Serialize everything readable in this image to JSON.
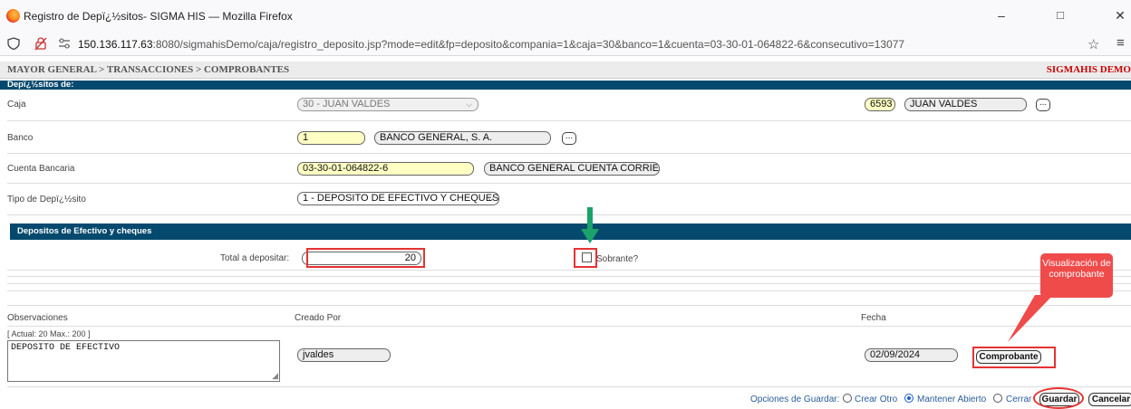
{
  "window": {
    "title": "Registro de Depï¿½sitos- SIGMA HIS — Mozilla Firefox",
    "controls": {
      "minimize": "–",
      "maximize": "□",
      "close": "✕"
    }
  },
  "urlbar": {
    "host": "150.136.117.63",
    "rest": ":8080/sigmahisDemo/caja/registro_deposito.jsp?mode=edit&fp=deposito&compania=1&caja=30&banco=1&cuenta=03-30-01-064822-6&consecutivo=13077"
  },
  "header": {
    "breadcrumb": "MAYOR GENERAL > TRANSACCIONES > COMPROBANTES",
    "brand": "SIGMAHIS DEMO"
  },
  "section_depositos": {
    "title": "Depï¿½sitos de:"
  },
  "caja": {
    "label": "Caja",
    "select_value": "30 - JUAN VALDES",
    "code": "6593",
    "name": "JUAN VALDES",
    "lookup": "..."
  },
  "banco": {
    "label": "Banco",
    "code": "1",
    "name": "BANCO GENERAL, S. A.",
    "lookup": "..."
  },
  "cuenta": {
    "label": "Cuenta Bancaria",
    "number": "03-30-01-064822-6",
    "name": "BANCO GENERAL CUENTA CORRIENTE"
  },
  "tipo": {
    "label": "Tipo de Depï¿½sito",
    "select_value": "1 - DEPOSITO DE EFECTIVO Y CHEQUES"
  },
  "section_efectivo": {
    "title": "Depositos de Efectivo y cheques"
  },
  "total": {
    "label": "Total a depositar:",
    "value": "20"
  },
  "sobrante": {
    "label": "Sobrante?",
    "checked": false
  },
  "observaciones": {
    "label": "Observaciones",
    "counter": "[ Actual: 20   Max.: 200 ]",
    "text": "DEPOSITO DE EFECTIVO"
  },
  "creado_por": {
    "label": "Creado Por",
    "value": "jvaldes"
  },
  "fecha": {
    "label": "Fecha",
    "value": "02/09/2024"
  },
  "comprobante_button": "Comprobante",
  "callout": {
    "text": "Visualización de comprobante"
  },
  "save_options": {
    "label": "Opciones de Guardar:",
    "options": [
      {
        "label": "Crear Otro",
        "selected": false
      },
      {
        "label": "Mantener Abierto",
        "selected": true
      },
      {
        "label": "Cerrar",
        "selected": false
      }
    ],
    "save_button": "Guardar",
    "cancel_button": "Cancelar"
  },
  "colors": {
    "band": "#054a6e",
    "highlight": "#e53333",
    "callout": "#ef4b4b",
    "arrow": "#1aa36b",
    "field_yellow": "#ffffc4"
  }
}
